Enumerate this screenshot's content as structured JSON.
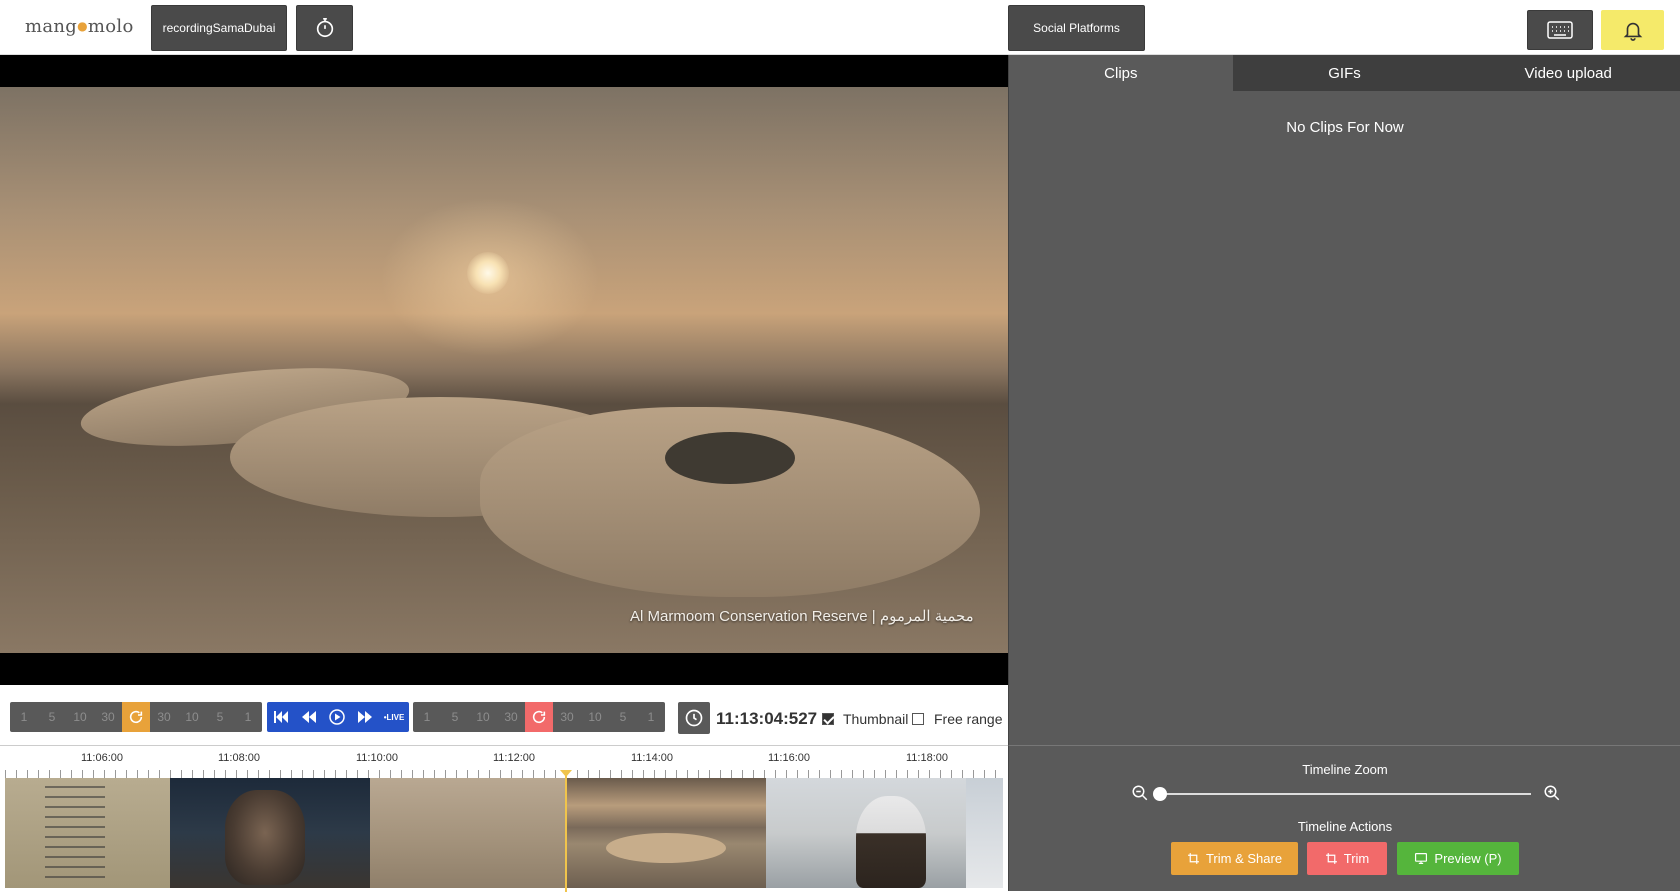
{
  "header": {
    "logo": "mang",
    "logo_suffix": "molo",
    "recording_label": "recordingSamaDubai",
    "social_label": "Social Platforms"
  },
  "video": {
    "caption": "Al Marmoom Conservation Reserve | محمية المرموم"
  },
  "controls": {
    "rewind_steps": [
      "1",
      "5",
      "10",
      "30"
    ],
    "forward_steps": [
      "30",
      "10",
      "5",
      "1"
    ],
    "live_label": "•LIVE",
    "timecode": "11:13:04:527",
    "thumbnail_label": "Thumbnail",
    "thumbnail_checked": true,
    "free_range_label": "Free range",
    "free_range_checked": false
  },
  "timeline": {
    "ticks": [
      "11:06:00",
      "11:08:00",
      "11:10:00",
      "11:12:00",
      "11:14:00",
      "11:16:00",
      "11:18:00"
    ],
    "zoom_title": "Timeline Zoom",
    "zoom_level": 0,
    "actions_title": "Timeline Actions",
    "trim_share_label": "Trim & Share",
    "trim_label": "Trim",
    "preview_label": "Preview (P)"
  },
  "panel": {
    "tabs": [
      "Clips",
      "GIFs",
      "Video upload"
    ],
    "active_tab": "Clips",
    "empty_message": "No Clips For Now"
  },
  "colors": {
    "accent_orange": "#e8a23a",
    "accent_red": "#f26a6a",
    "accent_green": "#55b53c",
    "accent_blue": "#2452c8",
    "bell_yellow": "#f5ea6a"
  }
}
